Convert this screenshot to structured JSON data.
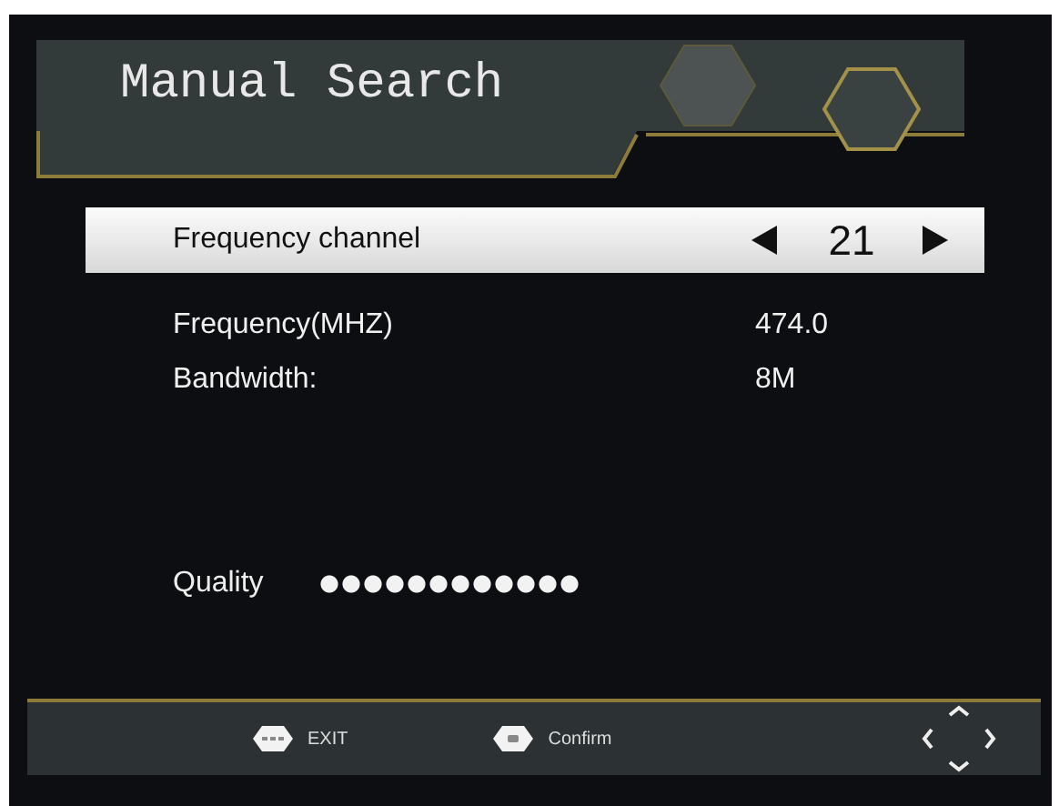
{
  "header": {
    "title": "Manual Search"
  },
  "rows": [
    {
      "kind": "selector",
      "label": "Frequency channel",
      "value": "21",
      "selected": true
    },
    {
      "kind": "info",
      "label": "Frequency(MHZ)",
      "value": "474.0",
      "selected": false
    },
    {
      "kind": "info",
      "label": "Bandwidth:",
      "value": "8M",
      "selected": false
    }
  ],
  "quality": {
    "label": "Quality",
    "level": 1.0
  },
  "footer": {
    "hints": [
      {
        "kind": "exit",
        "label": "EXIT"
      },
      {
        "kind": "ok",
        "label": "Confirm"
      }
    ]
  }
}
